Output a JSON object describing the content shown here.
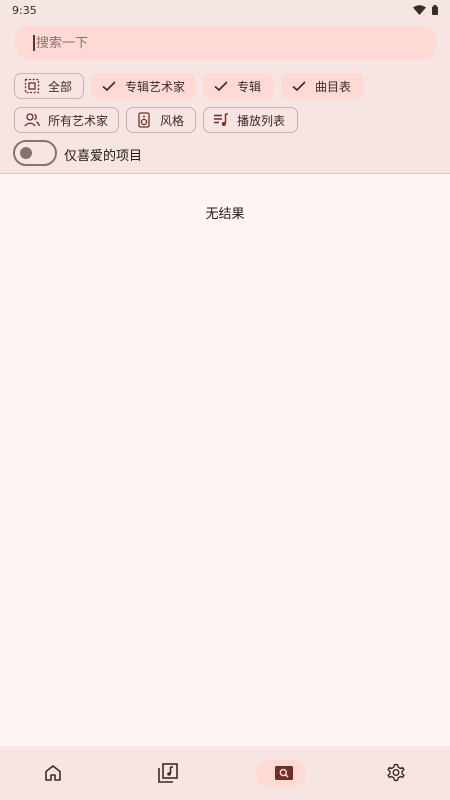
{
  "status_bar": {
    "time": "9:35"
  },
  "search": {
    "placeholder": "搜索一下",
    "value": ""
  },
  "filters": {
    "all": "全部",
    "album_artists": "专辑艺术家",
    "albums": "专辑",
    "tracks": "曲目表",
    "all_artists": "所有艺术家",
    "genres": "风格",
    "playlists": "播放列表"
  },
  "favorites_only": {
    "label": "仅喜爱的项目",
    "checked": false
  },
  "results": {
    "empty_text": "无结果"
  },
  "nav": {
    "items": [
      {
        "name": "home",
        "icon": "home-icon",
        "active": false
      },
      {
        "name": "library",
        "icon": "music-library-icon",
        "active": false
      },
      {
        "name": "search",
        "icon": "search-icon",
        "active": true
      },
      {
        "name": "settings",
        "icon": "gear-icon",
        "active": false
      }
    ]
  },
  "colors": {
    "background": "#fff5f3",
    "surface": "#f6e5e2",
    "accent_container": "#ffd9d3",
    "icon": "#6d2f28"
  }
}
